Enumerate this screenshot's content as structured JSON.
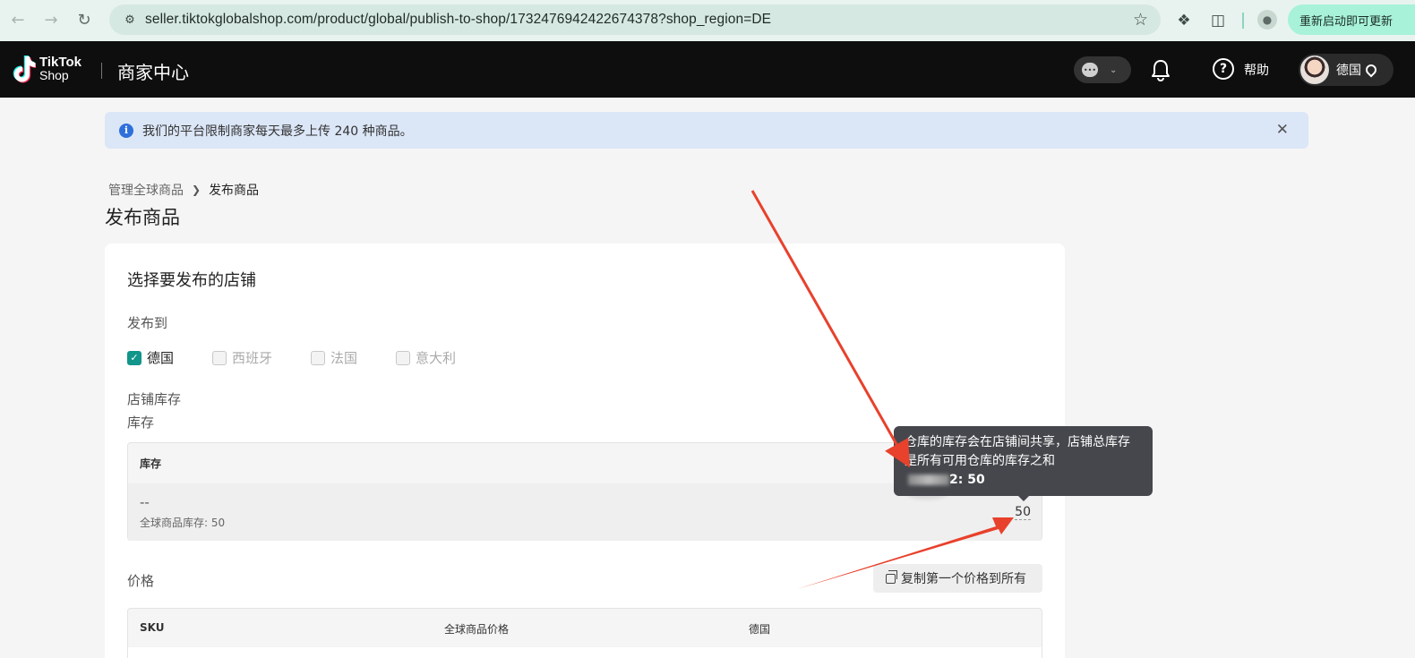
{
  "browser": {
    "url": "seller.tiktokglobalshop.com/product/global/publish-to-shop/1732476942422674378?shop_region=DE",
    "update_label": "重新启动即可更新"
  },
  "header": {
    "logo_line1": "TikTok",
    "logo_line2": "Shop",
    "title": "商家中心",
    "help_label": "帮助",
    "region_label": "德国"
  },
  "notice": {
    "text": "我们的平台限制商家每天最多上传 240 种商品。"
  },
  "breadcrumb": {
    "parent": "管理全球商品",
    "current": "发布商品"
  },
  "page": {
    "title": "发布商品"
  },
  "shops": {
    "section_title": "选择要发布的店铺",
    "publish_to_label": "发布到",
    "options": [
      {
        "label": "德国",
        "checked": true
      },
      {
        "label": "西班牙",
        "checked": false
      },
      {
        "label": "法国",
        "checked": false
      },
      {
        "label": "意大利",
        "checked": false
      }
    ]
  },
  "inventory": {
    "section_label": "店铺库存",
    "sub_label": "库存",
    "column_header": "库存",
    "row_value": "--",
    "global_stock": "全球商品库存: 50",
    "shop_value": "50"
  },
  "tooltip": {
    "line1": "仓库的库存会在店铺间共享，店铺总库存",
    "line2": "是所有可用仓库的库存之和",
    "line3": "2: 50"
  },
  "price": {
    "label": "价格",
    "copy_button": "复制第一个价格到所有",
    "columns": [
      "SKU",
      "全球商品价格",
      "德国"
    ]
  },
  "colors": {
    "accent": "#12958a",
    "arrow": "#e8412c",
    "header_bg": "#0e0e0e"
  }
}
